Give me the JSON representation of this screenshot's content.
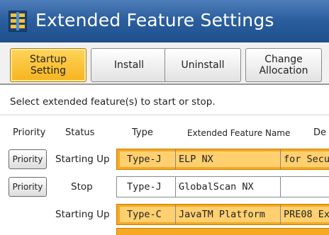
{
  "window": {
    "title": "Extended Feature Settings",
    "icon": "extended-feature-icon"
  },
  "tabs": [
    {
      "label_line1": "Startup",
      "label_line2": "Setting",
      "active": true
    },
    {
      "label_line1": "Install",
      "label_line2": "",
      "active": false
    },
    {
      "label_line1": "Uninstall",
      "label_line2": "",
      "active": false
    },
    {
      "label_line1": "Change",
      "label_line2": "Allocation",
      "active": false
    }
  ],
  "instruction": "Select extended feature(s) to start or stop.",
  "columns": {
    "priority": "Priority",
    "status": "Status",
    "type": "Type",
    "name": "Extended Feature Name",
    "desc": "De"
  },
  "rows": [
    {
      "priority_button": "Priority",
      "status": "Starting Up",
      "type": "Type-J",
      "name": "ELP NX",
      "desc": "for Secu",
      "highlighted": true
    },
    {
      "priority_button": "Priority",
      "status": "Stop",
      "type": "Type-J",
      "name": "GlobalScan NX",
      "desc": "",
      "highlighted": false
    },
    {
      "priority_button": "",
      "status": "Starting Up",
      "type": "Type-C",
      "name": "JavaTM Platform",
      "desc": "PRE08 Ex",
      "highlighted": true
    }
  ],
  "colors": {
    "titlebar": "#2c5f9f",
    "active_tab": "#f6b41e",
    "row_highlight": "#f7a823"
  }
}
